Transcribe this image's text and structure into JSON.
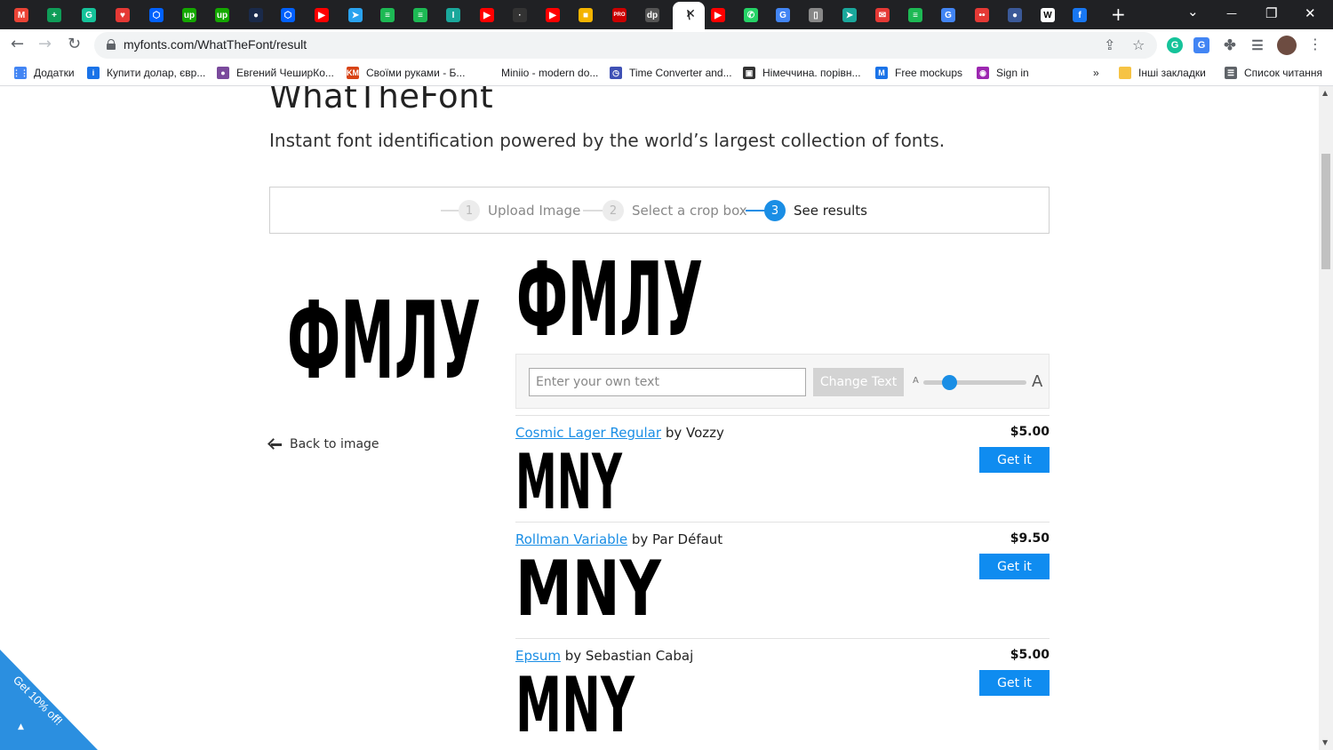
{
  "browser": {
    "active_tab_favicon_text": "\\",
    "new_tab_label": "+",
    "window_controls": {
      "dropdown": "⌄",
      "minimize": "—",
      "restore": "❐",
      "close": "✕"
    },
    "url": "myfonts.com/WhatTheFont/result",
    "tabs": [
      {
        "letter": "M",
        "color": "#ea4335"
      },
      {
        "letter": "+",
        "color": "#0f9d58"
      },
      {
        "letter": "G",
        "color": "#15c39a"
      },
      {
        "letter": "♥",
        "color": "#e53935"
      },
      {
        "letter": "⬡",
        "color": "#0061fe"
      },
      {
        "letter": "up",
        "color": "#14a800"
      },
      {
        "letter": "up",
        "color": "#14a800"
      },
      {
        "letter": "●",
        "color": "#1a2a4a"
      },
      {
        "letter": "⬡",
        "color": "#0061fe"
      },
      {
        "letter": "▶",
        "color": "#ff0000"
      },
      {
        "letter": "➤",
        "color": "#2aa3ef"
      },
      {
        "letter": "≡",
        "color": "#1db954"
      },
      {
        "letter": "≡",
        "color": "#1db954"
      },
      {
        "letter": "I",
        "color": "#1aa89c"
      },
      {
        "letter": "▶",
        "color": "#ff0000"
      },
      {
        "letter": "·",
        "color": "#333333"
      },
      {
        "letter": "▶",
        "color": "#ff0000"
      },
      {
        "letter": "■",
        "color": "#f4b400"
      },
      {
        "letter": "PRO",
        "color": "#cc0000"
      },
      {
        "letter": "dp",
        "color": "#555555"
      },
      {
        "letter": "▶",
        "color": "#ff0000"
      },
      {
        "letter": "✆",
        "color": "#25d366"
      },
      {
        "letter": "G",
        "color": "#4285f4"
      },
      {
        "letter": "▯",
        "color": "#888888"
      },
      {
        "letter": "➤",
        "color": "#1aa89c"
      },
      {
        "letter": "✉",
        "color": "#e53935"
      },
      {
        "letter": "≡",
        "color": "#1db954"
      },
      {
        "letter": "G",
        "color": "#4285f4"
      },
      {
        "letter": "••",
        "color": "#e53935"
      },
      {
        "letter": "●",
        "color": "#3b5998"
      },
      {
        "letter": "W",
        "color": "#ffffff"
      },
      {
        "letter": "f",
        "color": "#1877f2"
      }
    ],
    "bookmarks_more": "»",
    "bookmarks": [
      {
        "label": "Додатки",
        "color": "#4285f4",
        "glyph": "⋮⋮"
      },
      {
        "label": "Купити долар, євр...",
        "color": "#1a73e8",
        "glyph": "i"
      },
      {
        "label": "Евгений ЧеширКо...",
        "color": "#7a4a9c",
        "glyph": "●"
      },
      {
        "label": "Своїми руками - Б...",
        "color": "#d84315",
        "glyph": "KM"
      },
      {
        "label": "Miniio - modern do...",
        "color": "#ffffff",
        "glyph": ""
      },
      {
        "label": "Time Converter and...",
        "color": "#3f51b5",
        "glyph": "◷"
      },
      {
        "label": "Німеччина. порівн...",
        "color": "#333333",
        "glyph": "▣"
      },
      {
        "label": "Free mockups",
        "color": "#1a73e8",
        "glyph": "M"
      },
      {
        "label": "Sign in",
        "color": "#9c27b0",
        "glyph": "◉"
      }
    ],
    "bookmarks_right": [
      {
        "label": "Інші закладки",
        "color": "#f6c344",
        "glyph": ""
      },
      {
        "label": "Список читання",
        "color": "#5f6368",
        "glyph": "☰"
      }
    ]
  },
  "page": {
    "title": "WhatTheFont",
    "tagline": "Instant font identification powered by the world’s largest collection of fonts.",
    "steps": [
      {
        "num": "1",
        "label": "Upload Image"
      },
      {
        "num": "2",
        "label": "Select a crop box"
      },
      {
        "num": "3",
        "label": "See results"
      }
    ],
    "sample_text": "ФМЛУ",
    "controls": {
      "input_placeholder": "Enter your own text",
      "input_value": "",
      "change_text_label": "Change Text",
      "size_small_label": "A",
      "size_large_label": "A",
      "size_slider_level": 0.25
    },
    "back_label": "Back to image",
    "results": [
      {
        "name": "Cosmic Lager Regular",
        "by": "by",
        "foundry": "Vozzy",
        "price": "$5.00",
        "button": "Get it",
        "preview": "MNY"
      },
      {
        "name": "Rollman Variable",
        "by": "by",
        "foundry": "Par Défaut",
        "price": "$9.50",
        "button": "Get it",
        "preview": "MNY"
      },
      {
        "name": "Epsum",
        "by": "by",
        "foundry": "Sebastian Cabaj",
        "price": "$5.00",
        "button": "Get it",
        "preview": "MNY"
      }
    ],
    "promo": {
      "label": "Get 10% off!",
      "caret": "▲",
      "color": "#2b8fe0"
    }
  }
}
